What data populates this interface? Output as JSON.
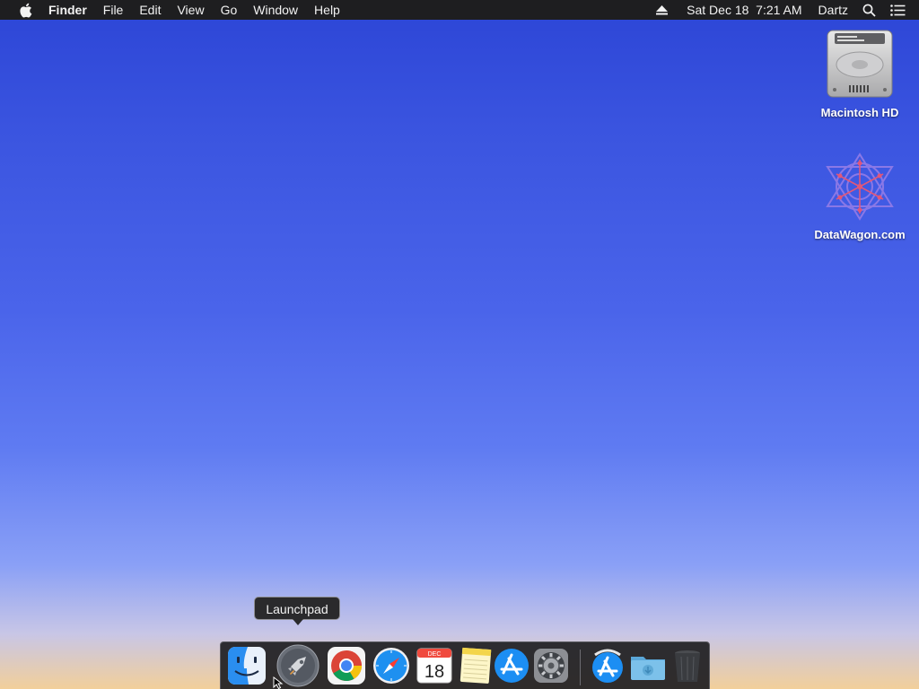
{
  "menubar": {
    "app_name": "Finder",
    "menus": [
      "File",
      "Edit",
      "View",
      "Go",
      "Window",
      "Help"
    ],
    "datetime": "Sat Dec 18  7:21 AM",
    "user": "Dartz",
    "icons": [
      "apple-icon",
      "eject-icon",
      "spotlight-search-icon",
      "notification-list-icon"
    ]
  },
  "desktop": {
    "icons": [
      {
        "label": "Macintosh HD",
        "icon": "hard-drive-icon"
      },
      {
        "label": "DataWagon.com",
        "icon": "network-share-icon"
      }
    ]
  },
  "dock": {
    "tooltip": "Launchpad",
    "calendar": {
      "month": "DEC",
      "day": "18"
    },
    "items": [
      {
        "name": "Finder",
        "icon": "finder-icon",
        "running": true
      },
      {
        "name": "Launchpad",
        "icon": "launchpad-icon"
      },
      {
        "name": "Google Chrome",
        "icon": "chrome-icon"
      },
      {
        "name": "Safari",
        "icon": "safari-icon"
      },
      {
        "name": "Calendar",
        "icon": "calendar-icon"
      },
      {
        "name": "Notes",
        "icon": "notes-icon"
      },
      {
        "name": "App Store",
        "icon": "app-store-icon"
      },
      {
        "name": "System Preferences",
        "icon": "system-preferences-icon"
      },
      {
        "name": "Applications",
        "icon": "applications-folder-icon"
      },
      {
        "name": "Downloads",
        "icon": "downloads-folder-icon"
      },
      {
        "name": "Trash",
        "icon": "trash-icon"
      }
    ]
  },
  "colors": {
    "menubar_bg": "#1e1e20",
    "desktop_top": "#2c45d6",
    "desktop_bottom": "#f2cf9a"
  }
}
